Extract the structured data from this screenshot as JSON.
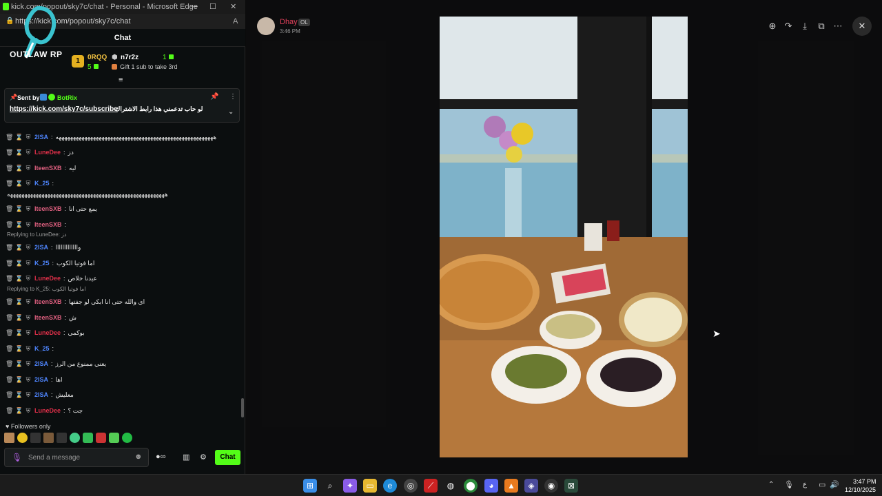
{
  "edge": {
    "title": "kick.com/popout/sky7c/chat - Personal - Microsoft Edge",
    "url": "https://kick.com/popout/sky7c/chat",
    "aa": "A"
  },
  "logo": {
    "text": "OUTLAW RP"
  },
  "chat": {
    "header": "Chat",
    "leaders": [
      {
        "name": "0RQQ",
        "count": "5"
      },
      {
        "name": "n7r2z",
        "count": "1"
      }
    ],
    "gift_text": "Gift 1 sub to take 3rd",
    "pinned": {
      "sent_by_label": "Sent by",
      "sender": "BotRix",
      "link": "https://kick.com/sky7c/subscribe",
      "text": "لو حاب تدعمني هذا رابط الاشتراك"
    },
    "messages": [
      {
        "user": "2ISA",
        "color": "blue",
        "text": "هههههههههههههههههههههههههههههههههههههههههههههههههههههههه"
      },
      {
        "user": "LuneDee",
        "color": "red",
        "text": "دز"
      },
      {
        "user": "IteenSXB",
        "color": "pink",
        "text": "ليه"
      },
      {
        "user": "K_25",
        "color": "blue",
        "text": ""
      },
      {
        "user": "",
        "color": "blue",
        "text": "هههههههههههههههههههههههههههههههههههههههههههههههههههههههه"
      },
      {
        "user": "IteenSXB",
        "color": "pink",
        "text": "يمع حتى انا"
      },
      {
        "user": "IteenSXB",
        "color": "pink",
        "text": ""
      },
      {
        "user": "2ISA",
        "color": "blue",
        "text": "وااااااااااااا",
        "reply": "Replying to LuneDee: دز"
      },
      {
        "user": "K_25",
        "color": "blue",
        "text": "اما فوتيا الكوب"
      },
      {
        "user": "LuneDee",
        "color": "red",
        "text": "عيدنا خلاص"
      },
      {
        "user": "IteenSXB",
        "color": "pink",
        "text": "اي والله حتى انا ابكي لو جفتها",
        "reply": "Replying to K_25: اما فوتيا الكوب"
      },
      {
        "user": "IteenSXB",
        "color": "pink",
        "text": "ش"
      },
      {
        "user": "LuneDee",
        "color": "red",
        "text": "بوكمي"
      },
      {
        "user": "K_25",
        "color": "blue",
        "text": ""
      },
      {
        "user": "2ISA",
        "color": "blue",
        "text": "يعني ممنوع من الرز"
      },
      {
        "user": "2ISA",
        "color": "blue",
        "text": "اها"
      },
      {
        "user": "2ISA",
        "color": "blue",
        "text": "معليش"
      },
      {
        "user": "LuneDee",
        "color": "red",
        "text": "جت ؟"
      }
    ],
    "followers_only": "Followers only",
    "input_placeholder": "Send a message",
    "send_label": "Chat"
  },
  "viewer": {
    "author": "Dhay",
    "badge": "OL",
    "time": "3:46 PM"
  },
  "taskbar": {
    "lang": "ع",
    "time": "3:47 PM",
    "date": "12/10/2025"
  }
}
